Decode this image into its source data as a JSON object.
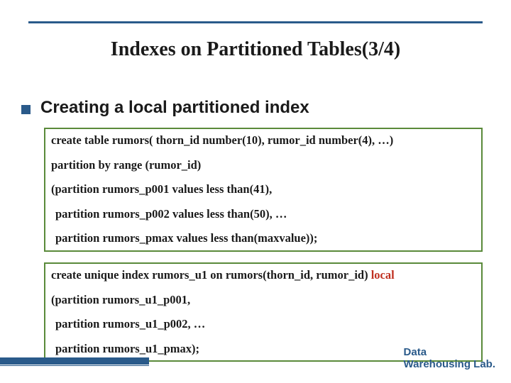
{
  "title": "Indexes on Partitioned Tables(3/4)",
  "bullet": "Creating a local partitioned index",
  "box1": {
    "l1": "create table rumors( thorn_id number(10), rumor_id number(4), …)",
    "l2": "partition by range (rumor_id)",
    "l3": "(partition rumors_p001 values less than(41),",
    "l4": "partition rumors_p002 values less than(50), …",
    "l5": "partition rumors_pmax values less than(maxvalue));"
  },
  "box2": {
    "l1a": "create unique index rumors_u1 on rumors(thorn_id, rumor_id) ",
    "l1b": "local",
    "l2": "(partition rumors_u1_p001,",
    "l3": "partition rumors_u1_p002, …",
    "l4": "partition rumors_u1_pmax);"
  },
  "footer": {
    "l1": "Data",
    "l2": "Warehousing Lab."
  }
}
